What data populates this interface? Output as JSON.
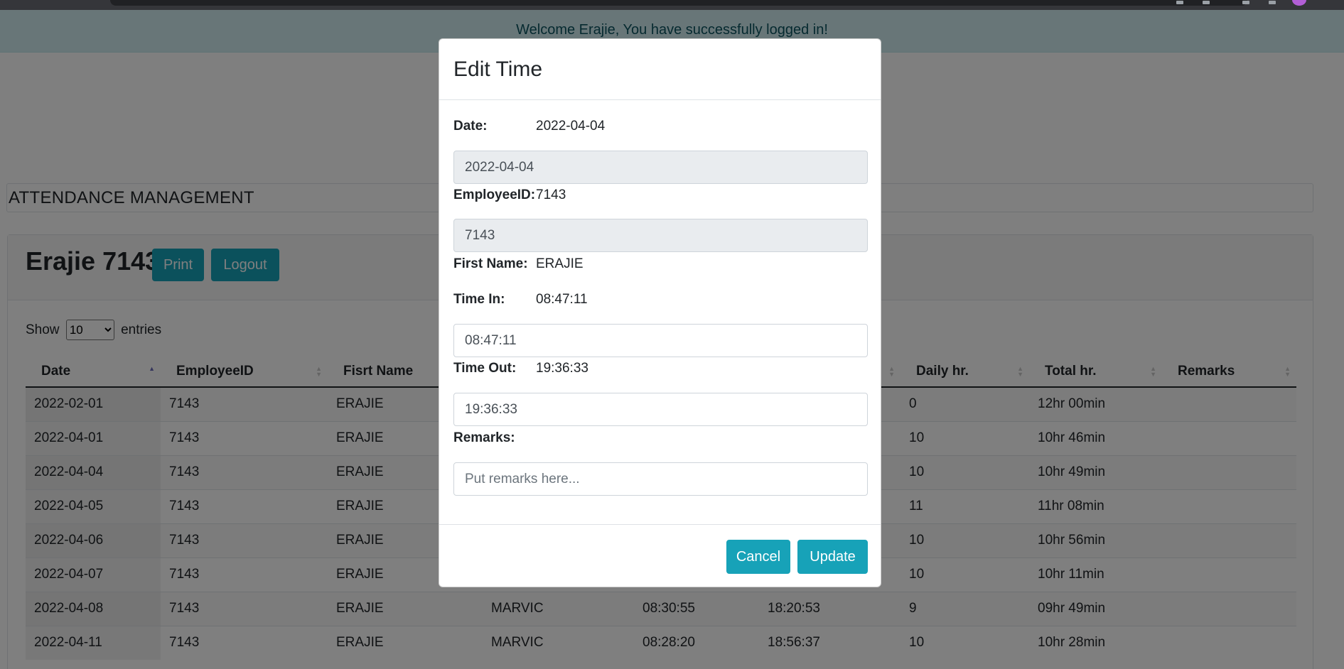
{
  "alert": {
    "message": "Welcome Erajie, You have successfully logged in!"
  },
  "page": {
    "heading": "ATTENDANCE MANAGEMENT"
  },
  "card": {
    "title": "Erajie 7143",
    "print_label": "Print",
    "logout_label": "Logout"
  },
  "length_control": {
    "show": "Show",
    "selected": "10",
    "entries": "entries"
  },
  "table": {
    "columns": [
      "Date",
      "EmployeeID",
      "Fisrt Name",
      "",
      "",
      "",
      "Daily hr.",
      "Total hr.",
      "Remarks"
    ],
    "rows": [
      [
        "2022-02-01",
        "7143",
        "ERAJIE",
        "",
        "",
        "",
        "0",
        "12hr 00min",
        ""
      ],
      [
        "2022-04-01",
        "7143",
        "ERAJIE",
        "",
        "",
        "",
        "10",
        "10hr 46min",
        ""
      ],
      [
        "2022-04-04",
        "7143",
        "ERAJIE",
        "",
        "",
        "",
        "10",
        "10hr 49min",
        ""
      ],
      [
        "2022-04-05",
        "7143",
        "ERAJIE",
        "",
        "",
        "",
        "11",
        "11hr 08min",
        ""
      ],
      [
        "2022-04-06",
        "7143",
        "ERAJIE",
        "",
        "",
        "",
        "10",
        "10hr 56min",
        ""
      ],
      [
        "2022-04-07",
        "7143",
        "ERAJIE",
        "",
        "",
        "",
        "10",
        "10hr 11min",
        ""
      ],
      [
        "2022-04-08",
        "7143",
        "ERAJIE",
        "MARVIC",
        "08:30:55",
        "18:20:53",
        "9",
        "09hr 49min",
        ""
      ],
      [
        "2022-04-11",
        "7143",
        "ERAJIE",
        "MARVIC",
        "08:28:20",
        "18:56:37",
        "10",
        "10hr 28min",
        ""
      ]
    ]
  },
  "modal": {
    "title": "Edit Time",
    "date_label": "Date:",
    "date_value": "2022-04-04",
    "date_input": "2022-04-04",
    "employee_label": "EmployeeID:",
    "employee_value": "7143",
    "employee_input": "7143",
    "firstname_label": "First Name:",
    "firstname_value": "ERAJIE",
    "timein_label": "Time In:",
    "timein_value": "08:47:11",
    "timein_input": "08:47:11",
    "timeout_label": "Time Out:",
    "timeout_value": "19:36:33",
    "timeout_input": "19:36:33",
    "remarks_label": "Remarks:",
    "remarks_placeholder": "Put remarks here...",
    "cancel_label": "Cancel",
    "update_label": "Update"
  }
}
